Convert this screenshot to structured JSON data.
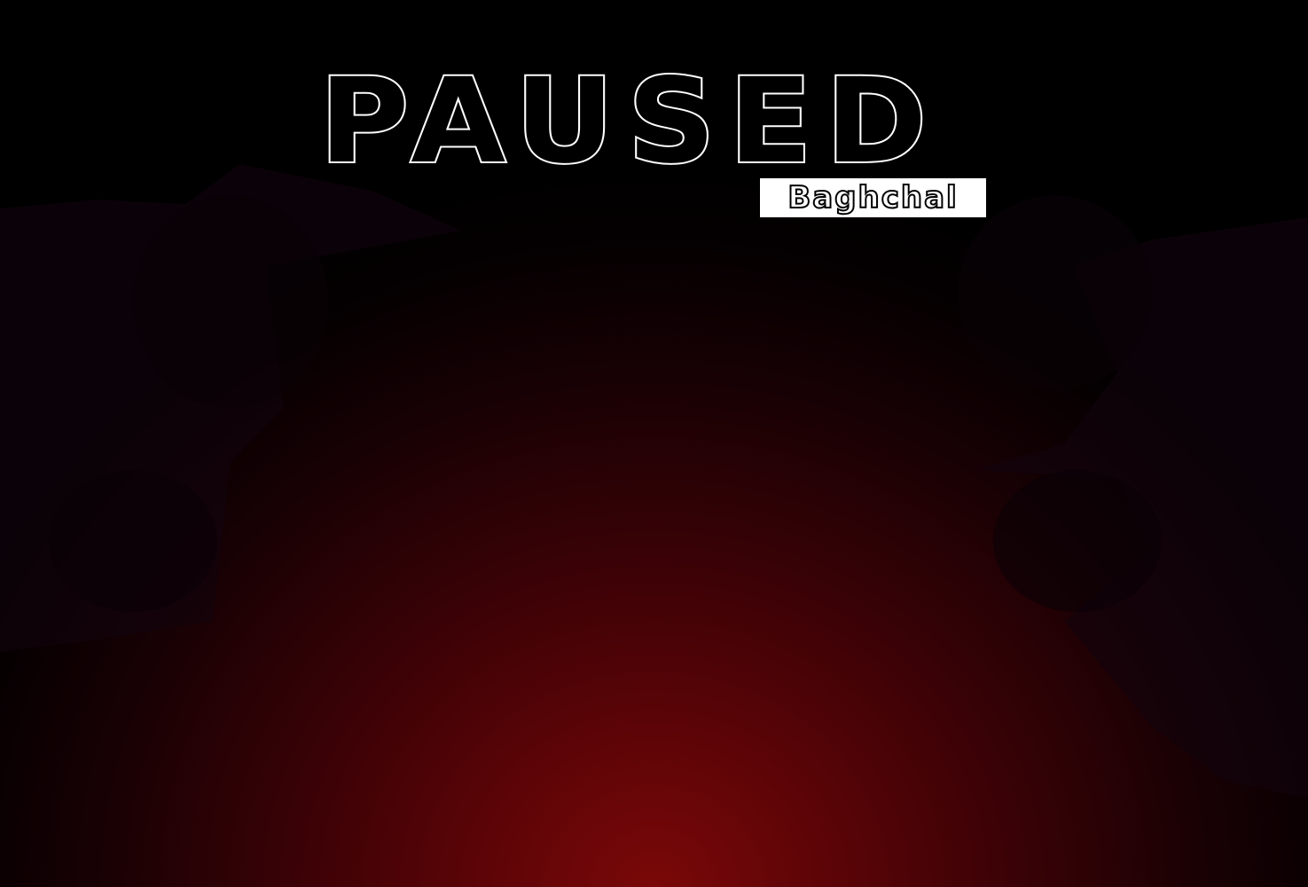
{
  "game": {
    "title": "PAUSED",
    "subtitle": "Baghchal"
  },
  "colors": {
    "background_center": "#7a0808",
    "background_edge": "#000000",
    "cloud_tint": "#150314",
    "title_outline": "#ffffff",
    "title_fill": "#000000",
    "subtitle_bg": "#ffffff"
  }
}
